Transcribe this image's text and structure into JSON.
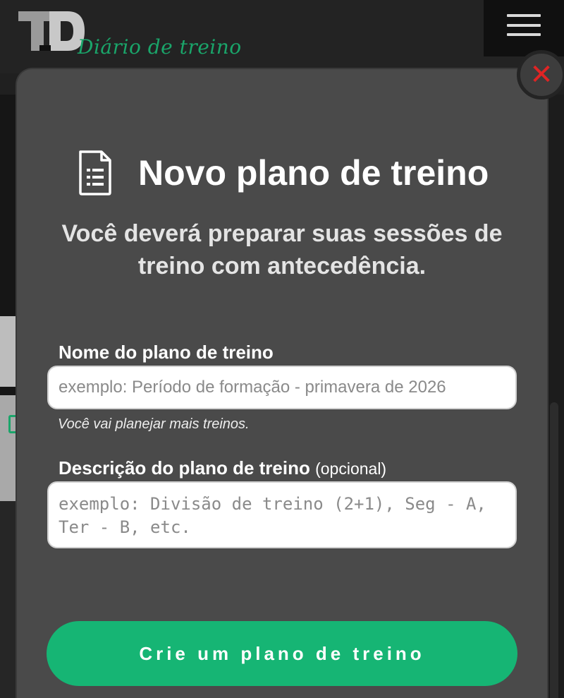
{
  "header": {
    "logo_mark": "TD",
    "logo_subtitle": "Diário de treino",
    "menu_icon": "hamburger-menu-icon"
  },
  "modal": {
    "close_icon": "close-x-icon",
    "title_icon": "document-list-icon",
    "title": "Novo plano de treino",
    "subtitle": "Você deverá preparar suas sessões de treino com antecedência.",
    "name_field": {
      "label": "Nome do plano de treino",
      "placeholder": "exemplo: Período de formação - primavera de 2026",
      "value": "",
      "hint": "Você vai planejar mais treinos."
    },
    "description_field": {
      "label": "Descrição do plano de treino",
      "optional_label": "(opcional)",
      "placeholder": "exemplo: Divisão de treino (2+1), Seg - A, Ter - B, etc.",
      "value": ""
    },
    "create_button": "Crie um plano de treino"
  },
  "colors": {
    "accent": "#16b574",
    "close": "#e02424",
    "modal_bg": "#4a4a4a",
    "topbar_bg": "#232323"
  }
}
